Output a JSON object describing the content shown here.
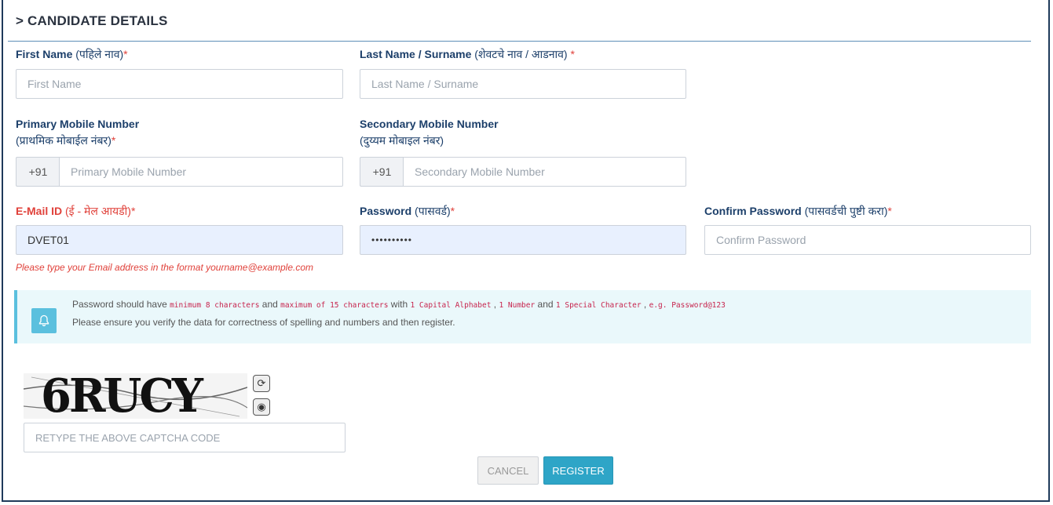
{
  "section": {
    "title": "> CANDIDATE DETAILS"
  },
  "first_name": {
    "label": "First Name",
    "label_dev": "(पहिले नाव)",
    "req": "*",
    "placeholder": "First Name"
  },
  "last_name": {
    "label": "Last Name / Surname",
    "label_dev": "(शेवटचे नाव / आडनाव)",
    "req": " *",
    "placeholder": "Last Name / Surname"
  },
  "primary_mobile": {
    "label": "Primary Mobile Number",
    "label_dev": "(प्राथमिक मोबाईल नंबर)",
    "req": "*",
    "prefix": "+91",
    "placeholder": "Primary Mobile Number"
  },
  "secondary_mobile": {
    "label": "Secondary Mobile Number",
    "label_dev": "(दुय्यम मोबाइल नंबर)",
    "prefix": "+91",
    "placeholder": "Secondary Mobile Number"
  },
  "email": {
    "label": "E-Mail ID",
    "label_dev": "(ई - मेल आयडी)",
    "req": "*",
    "value": "DVET01",
    "hint": "Please type your Email address in the format yourname@example.com"
  },
  "password": {
    "label": "Password",
    "label_dev": "(पासवर्ड)",
    "req": "*",
    "value": "••••••••••"
  },
  "confirm_password": {
    "label": "Confirm Password",
    "label_dev": "(पासवर्डची पुष्टी करा)",
    "req": "*",
    "placeholder": "Confirm Password"
  },
  "notice": {
    "icon": "bell-icon",
    "l1_a": "Password should have ",
    "l1_code1": "minimum 8 characters",
    "l1_b": " and ",
    "l1_code2": "maximum of 15 characters",
    "l1_c": " with ",
    "l1_code3": "1 Capital Alphabet",
    "l1_d": " , ",
    "l1_code4": "1 Number",
    "l1_e": " and ",
    "l1_code5": "1 Special Character",
    "l1_f": " , ",
    "l1_code6": "e.g. Password@123",
    "line2": "Please ensure you verify the data for correctness of spelling and numbers and then register."
  },
  "captcha": {
    "text": "6RUCY",
    "placeholder": "RETYPE THE ABOVE CAPTCHA CODE",
    "refresh_glyph": "⟳",
    "audio_glyph": "◉"
  },
  "buttons": {
    "cancel": "CANCEL",
    "register": "REGISTER"
  },
  "colors": {
    "label": "#1c3f6a",
    "required": "#e0413a",
    "accent": "#2ea5c7",
    "notice_bg": "#eaf8fb"
  }
}
